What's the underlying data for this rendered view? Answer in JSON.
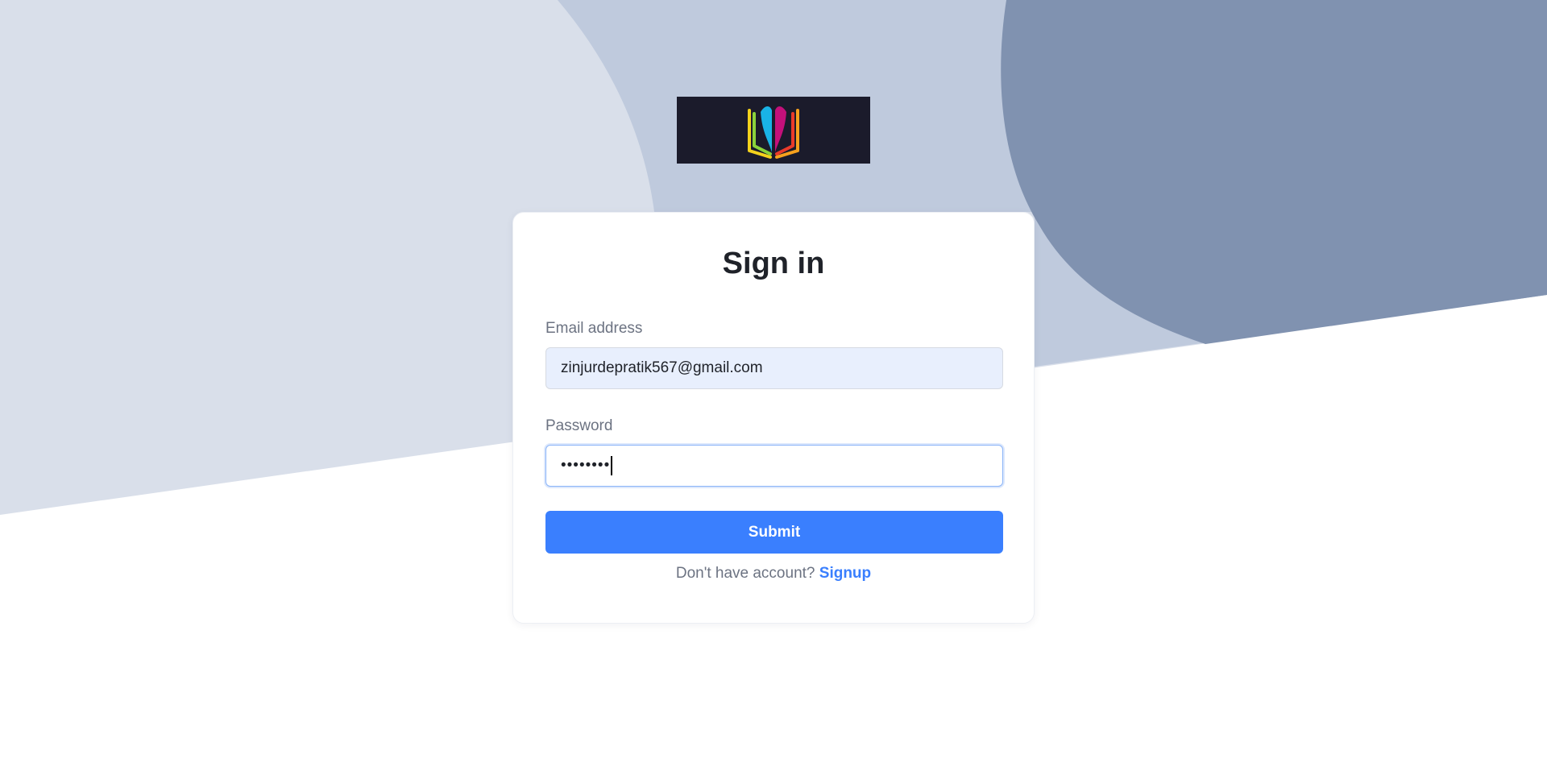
{
  "colors": {
    "background_light": "#d9dfea",
    "background_mid": "#bfcadd",
    "background_dark": "#8092b0",
    "card_background": "#ffffff",
    "email_field_background": "#e8effd",
    "accent": "#3a7ffe",
    "text_dark": "#1f2229",
    "text_muted": "#6c7382",
    "logo_background": "#1b1b2b"
  },
  "logo": {
    "icon": "open-book-icon"
  },
  "form": {
    "title": "Sign in",
    "email_label": "Email address",
    "email_value": "zinjurdepratik567@gmail.com",
    "password_label": "Password",
    "password_masked": "••••••••",
    "submit_label": "Submit"
  },
  "footer": {
    "prompt": "Don't have account?",
    "signup_label": "Signup"
  }
}
